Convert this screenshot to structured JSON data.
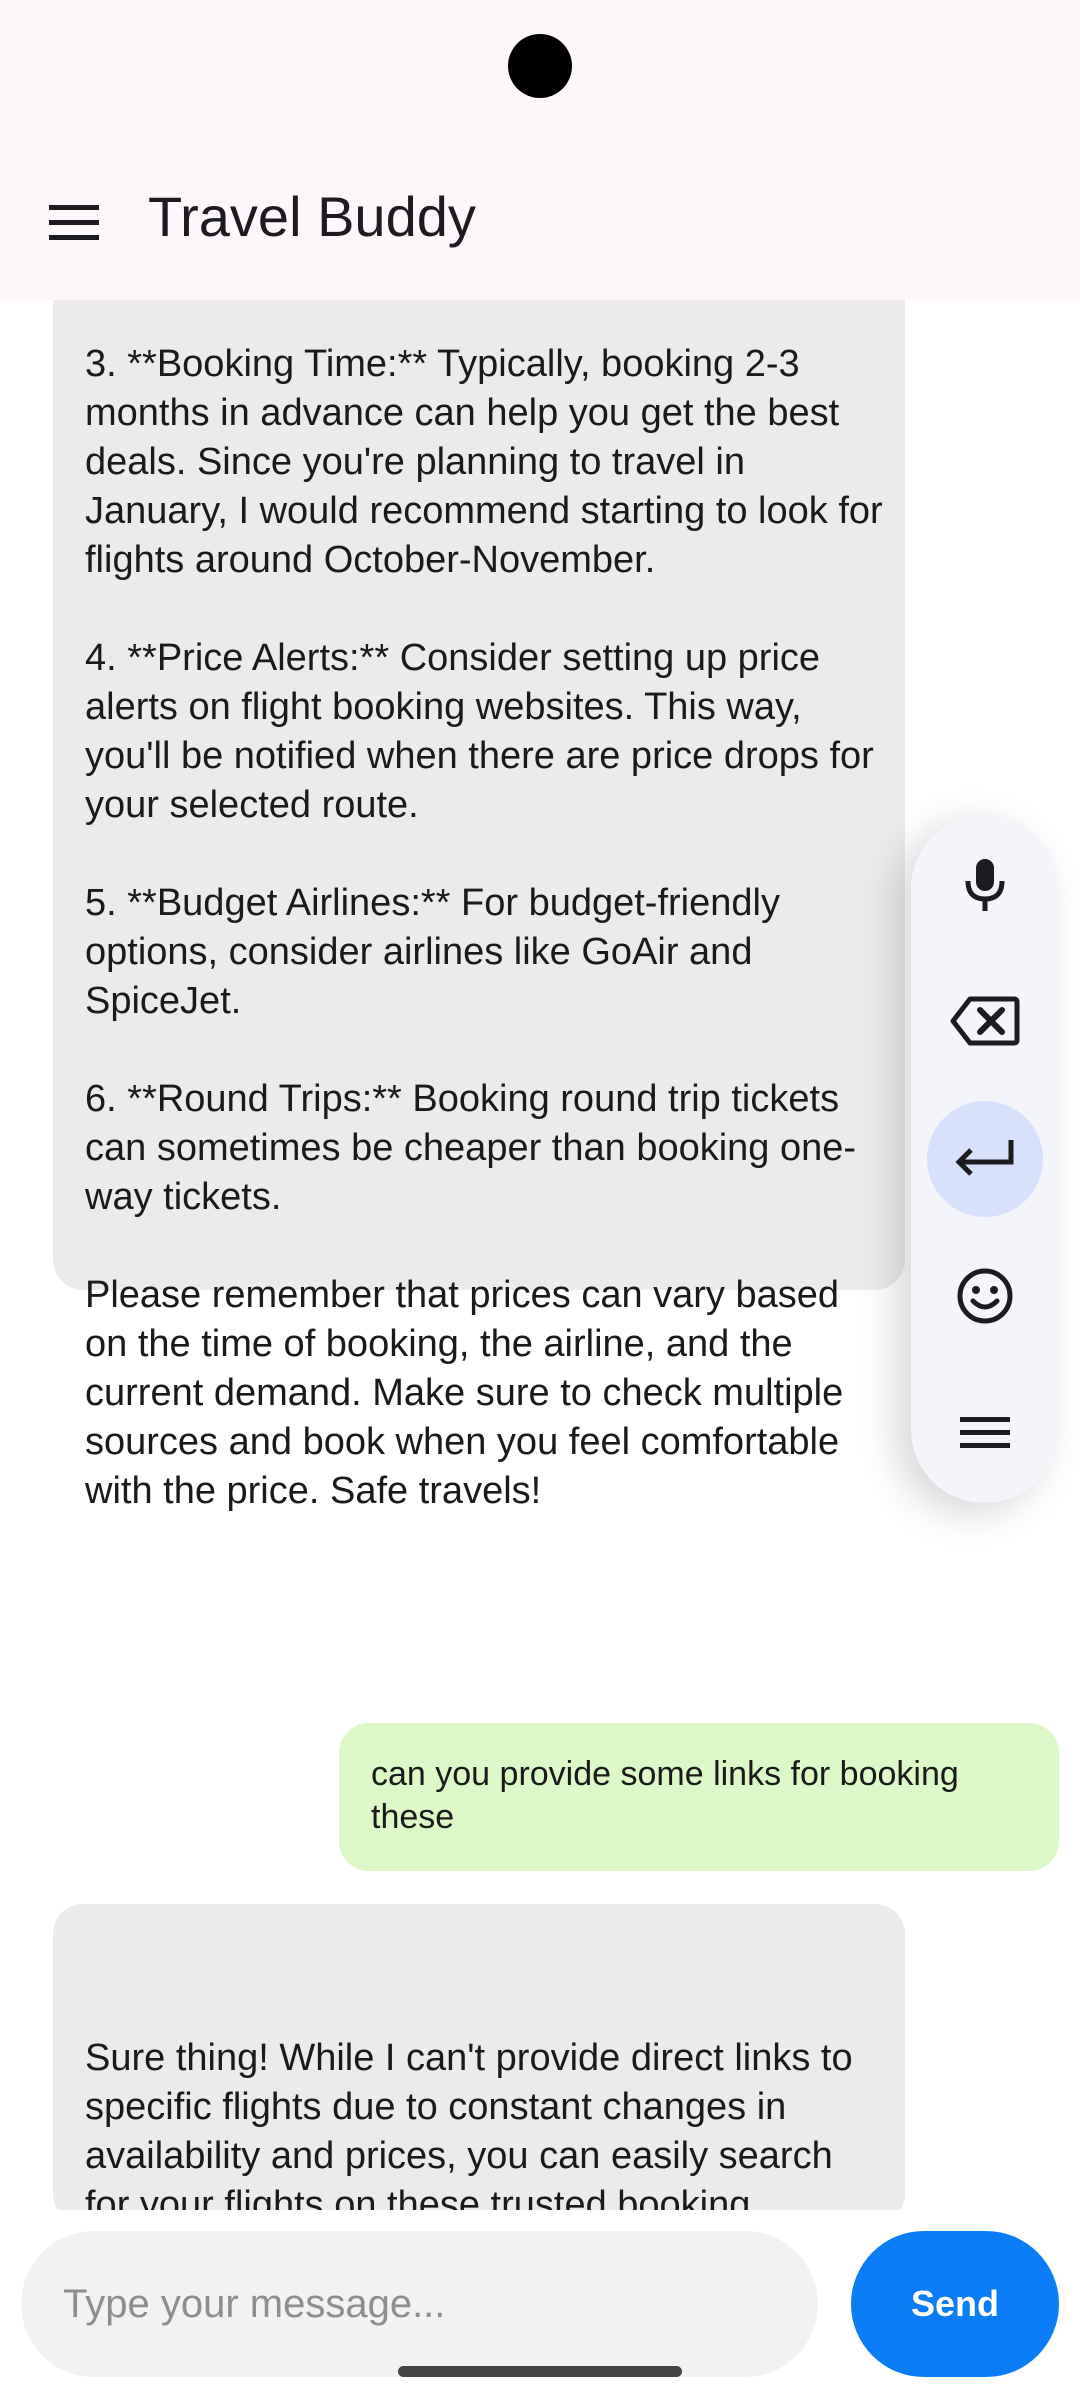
{
  "app": {
    "title": "Travel Buddy"
  },
  "messages": [
    {
      "role": "bot",
      "text": "India, GoAir, IndiGo, and SpiceJet.\n\n3. **Booking Time:** Typically, booking 2-3 months in advance can help you get the best deals. Since you're planning to travel in January, I would recommend starting to look for flights around October-November.\n\n4. **Price Alerts:** Consider setting up price alerts on flight booking websites. This way, you'll be notified when there are price drops for your selected route.\n\n5. **Budget Airlines:** For budget-friendly options, consider airlines like GoAir and SpiceJet.\n\n6. **Round Trips:** Booking round trip tickets can sometimes be cheaper than booking one-way tickets.\n\nPlease remember that prices can vary based on the time of booking, the airline, and the current demand. Make sure to check multiple sources and book when you feel comfortable with the price. Safe travels!"
    },
    {
      "role": "user",
      "text": "can you provide some links for booking these"
    },
    {
      "role": "bot",
      "text": "Sure thing! While I can't provide direct links to specific flights due to constant changes in availability and prices, you can easily search for your flights on these trusted booking platforms:"
    }
  ],
  "keyboard_toolbar": {
    "buttons": [
      "mic-icon",
      "backspace-icon",
      "enter-icon",
      "emoji-icon",
      "menu-icon"
    ],
    "active": "enter-icon"
  },
  "composer": {
    "placeholder": "Type your message...",
    "value": "",
    "send_label": "Send"
  },
  "colors": {
    "bot_bubble": "#ebebeb",
    "user_bubble": "#dcf8c6",
    "send_button": "#0a7cf5",
    "app_bar": "#fdf7fb"
  }
}
